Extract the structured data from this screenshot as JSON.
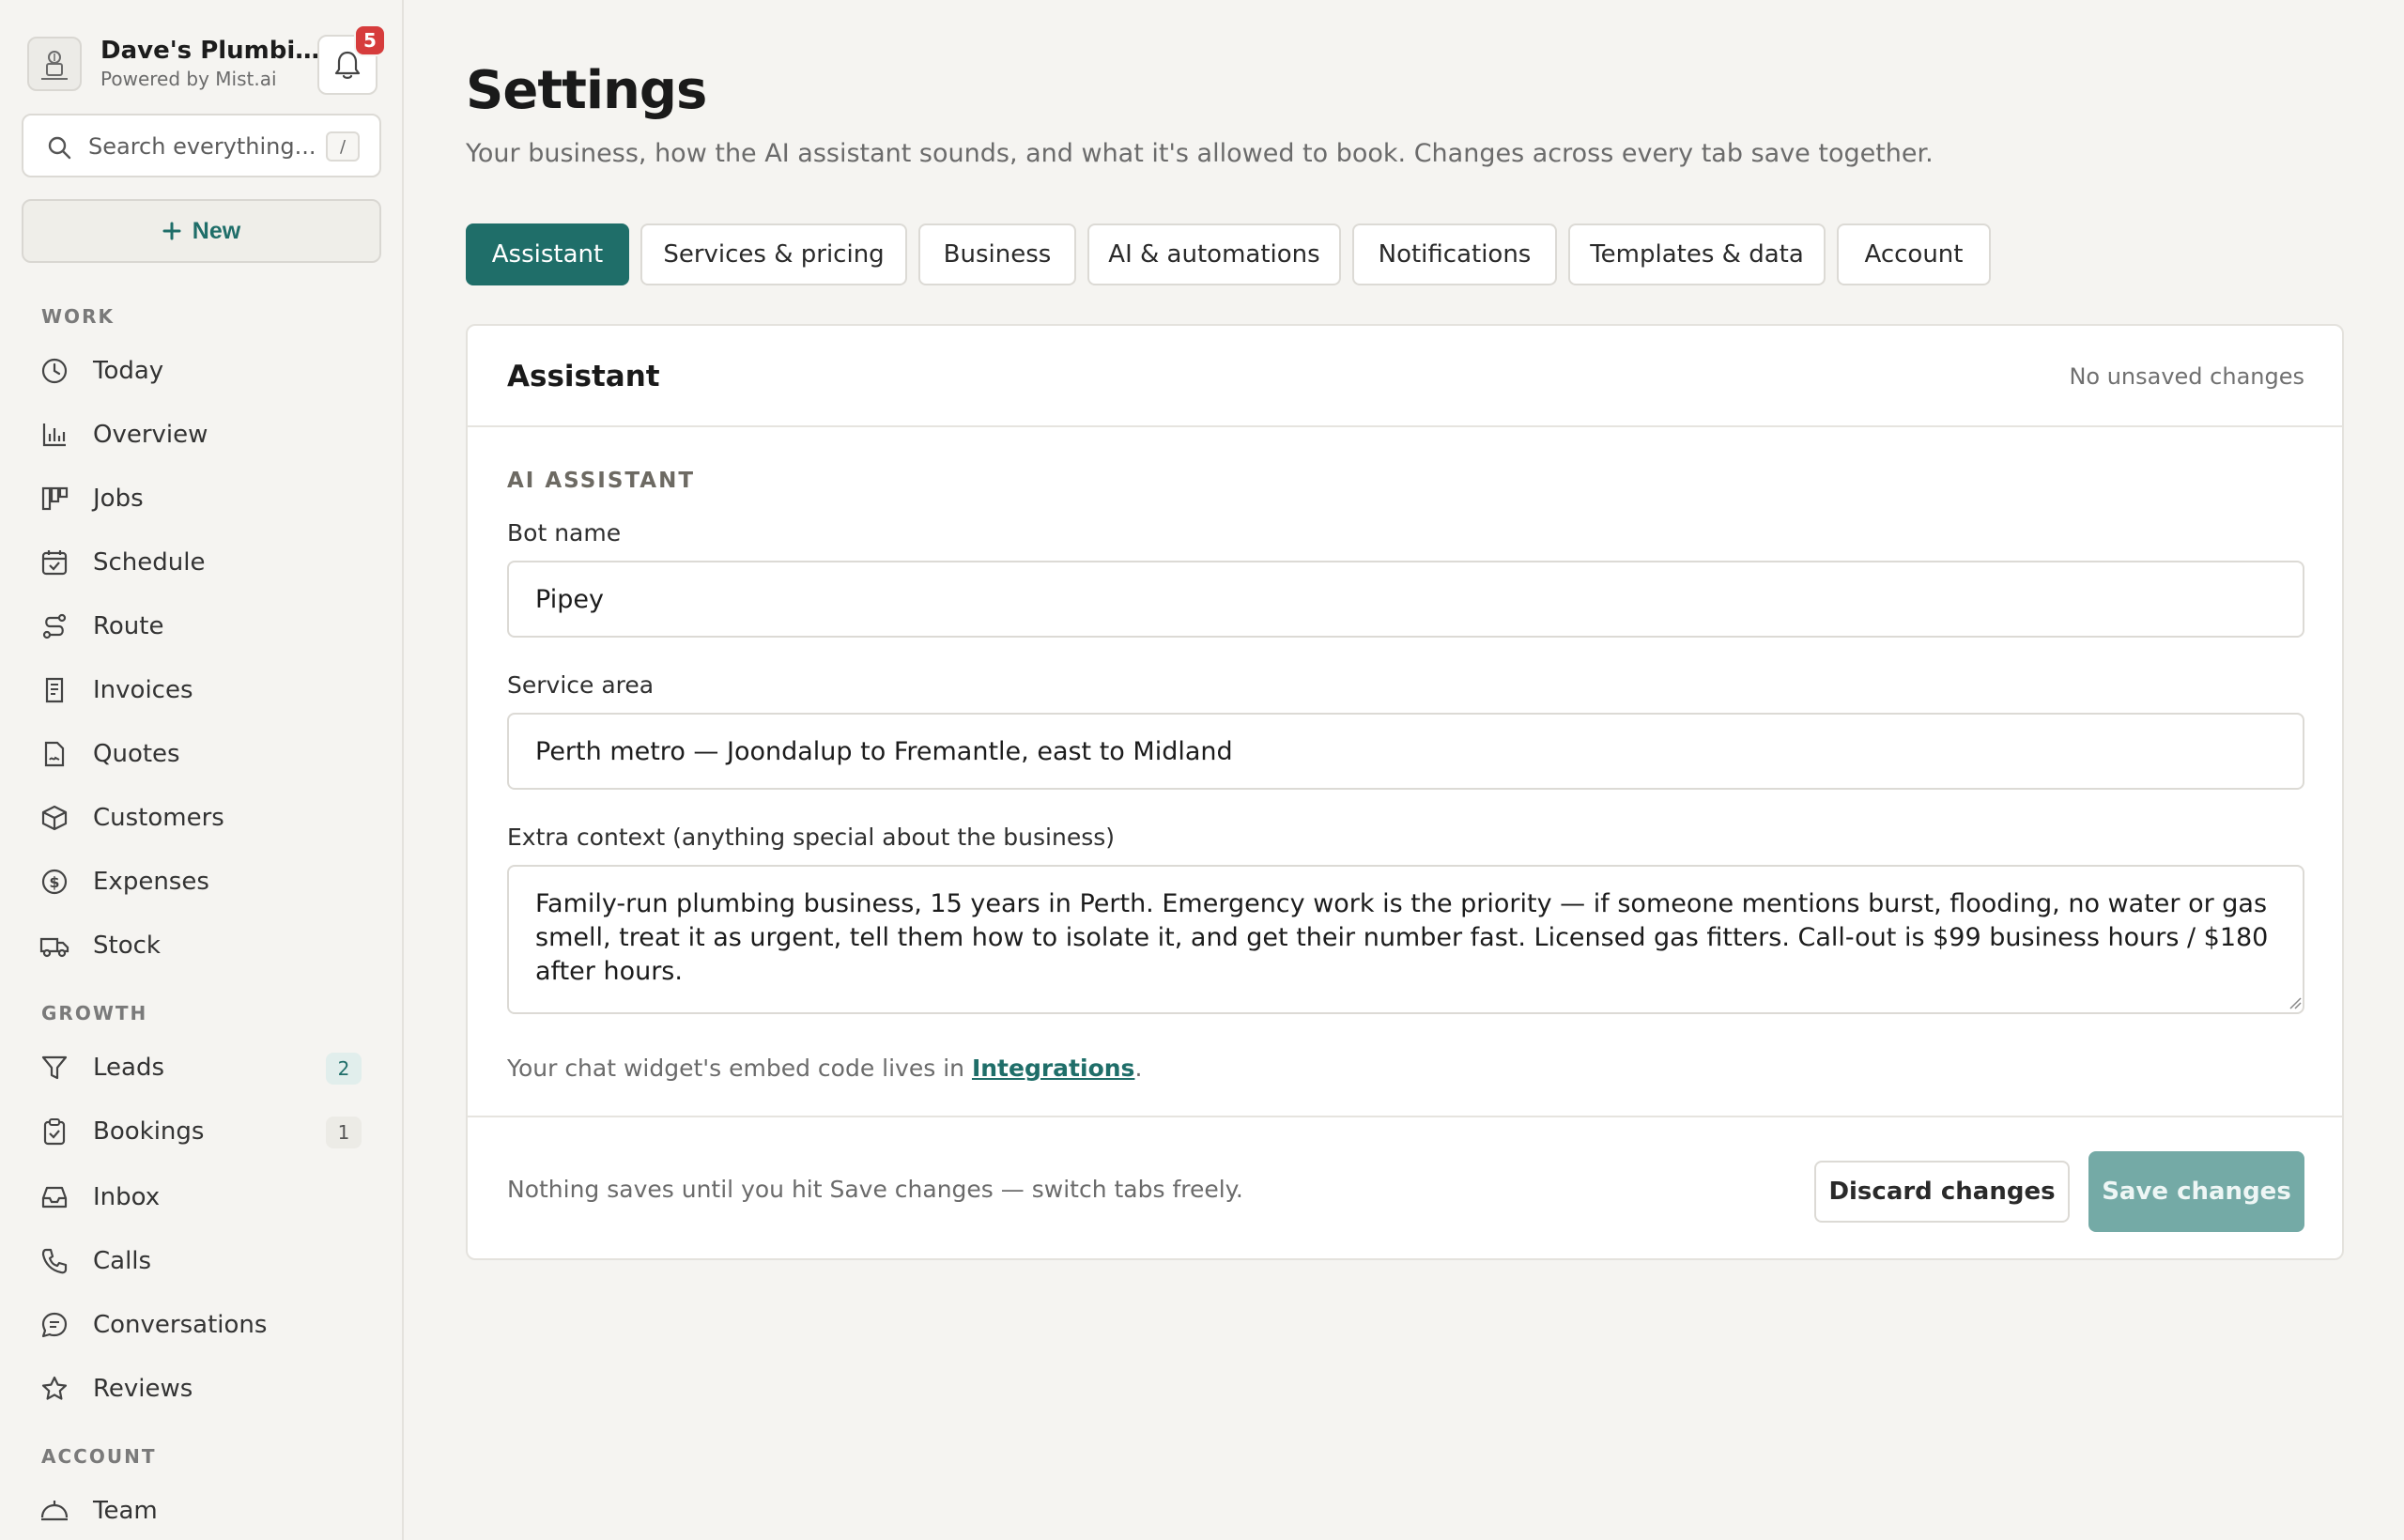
{
  "sidebar": {
    "brand": {
      "name": "Dave's Plumbin...",
      "subtitle": "Powered by Mist.ai",
      "icon": "plumber-logo-icon"
    },
    "notifications": {
      "count": "5",
      "icon": "bell-icon"
    },
    "search": {
      "placeholder": "Search everything...",
      "shortcut": "/"
    },
    "new_button": {
      "label": "New"
    },
    "sections": [
      {
        "label": "WORK",
        "items": [
          {
            "label": "Today",
            "icon": "clock-icon"
          },
          {
            "label": "Overview",
            "icon": "bar-chart-icon"
          },
          {
            "label": "Jobs",
            "icon": "kanban-icon"
          },
          {
            "label": "Schedule",
            "icon": "calendar-check-icon"
          },
          {
            "label": "Route",
            "icon": "route-icon"
          },
          {
            "label": "Invoices",
            "icon": "receipt-icon"
          },
          {
            "label": "Quotes",
            "icon": "file-signature-icon"
          },
          {
            "label": "Customers",
            "icon": "box-icon"
          },
          {
            "label": "Expenses",
            "icon": "dollar-circle-icon"
          },
          {
            "label": "Stock",
            "icon": "truck-icon"
          }
        ]
      },
      {
        "label": "GROWTH",
        "items": [
          {
            "label": "Leads",
            "icon": "funnel-icon",
            "badge": "2"
          },
          {
            "label": "Bookings",
            "icon": "clipboard-check-icon",
            "badge": "1"
          },
          {
            "label": "Inbox",
            "icon": "inbox-icon"
          },
          {
            "label": "Calls",
            "icon": "phone-icon"
          },
          {
            "label": "Conversations",
            "icon": "message-icon"
          },
          {
            "label": "Reviews",
            "icon": "star-icon"
          }
        ]
      },
      {
        "label": "ACCOUNT",
        "items": [
          {
            "label": "Team",
            "icon": "team-icon"
          }
        ]
      }
    ]
  },
  "header": {
    "title": "Settings",
    "subtitle": "Your business, how the AI assistant sounds, and what it's allowed to book. Changes across every tab save together."
  },
  "tabs": [
    {
      "label": "Assistant",
      "active": true
    },
    {
      "label": "Services & pricing"
    },
    {
      "label": "Business"
    },
    {
      "label": "AI & automations"
    },
    {
      "label": "Notifications"
    },
    {
      "label": "Templates & data"
    },
    {
      "label": "Account"
    }
  ],
  "card": {
    "title": "Assistant",
    "status": "No unsaved changes",
    "section_label": "AI ASSISTANT",
    "fields": {
      "bot_name": {
        "label": "Bot name",
        "value": "Pipey"
      },
      "service_area": {
        "label": "Service area",
        "value": "Perth metro — Joondalup to Fremantle, east to Midland"
      },
      "extra_context": {
        "label": "Extra context (anything special about the business)",
        "value": "Family-run plumbing business, 15 years in Perth. Emergency work is the priority — if someone mentions burst, flooding, no water or gas smell, treat it as urgent, tell them how to isolate it, and get their number fast. Licensed gas fitters. Call-out is $99 business hours / $180 after hours."
      }
    },
    "hint_prefix": "Your chat widget's embed code lives in ",
    "hint_link": "Integrations",
    "hint_suffix": ".",
    "footer_note": "Nothing saves until you hit Save changes — switch tabs freely.",
    "discard_label": "Discard changes",
    "save_label": "Save changes"
  },
  "colors": {
    "accent": "#1f6e69",
    "save_disabled": "#74aaa6",
    "badge_red": "#d63c3c",
    "leads_badge_bg": "#e1eeec",
    "bookings_badge_bg": "#ecebe6"
  }
}
